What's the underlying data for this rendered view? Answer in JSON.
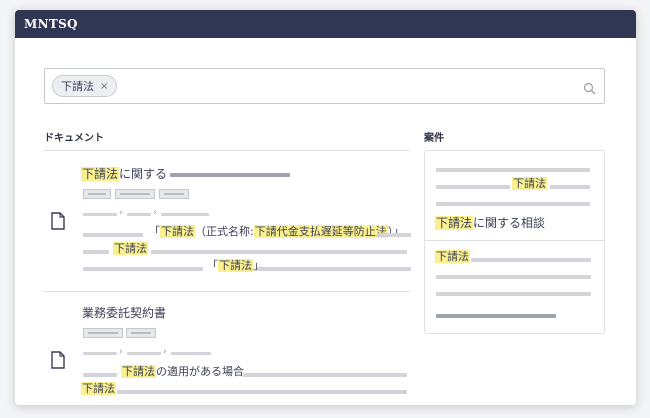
{
  "app": {
    "title": "MNTSQ"
  },
  "search": {
    "chip_label": "下請法",
    "chip_remove": "×"
  },
  "documents_section": {
    "label": "ドキュメント"
  },
  "cases_section": {
    "label": "案件"
  },
  "documents": [
    {
      "title_highlight": "下請法",
      "title_rest": "に関する",
      "snippet1": {
        "open_bracket": "「",
        "hl1": "下請法",
        "mid": "（正式名称:",
        "hl2": "下請代金支払遅延等防止法",
        "close": "）」"
      },
      "snippet2": {
        "hl": "下請法"
      },
      "snippet3": {
        "open_bracket": "「",
        "hl": "下請法",
        "close": "」"
      }
    },
    {
      "title": "業務委託契約書",
      "snippet1": {
        "hl": "下請法",
        "rest": "の適用がある場合、"
      },
      "snippet2": {
        "hl": "下請法"
      }
    }
  ],
  "case": {
    "top_hl": "下請法",
    "title_highlight": "下請法",
    "title_rest": "に関する相談",
    "body_hl": "下請法"
  },
  "icons": {
    "search": "search-icon",
    "document": "document-icon",
    "chevron": "›"
  },
  "colors": {
    "titlebar": "#303752",
    "highlight": "#fbf08f"
  }
}
